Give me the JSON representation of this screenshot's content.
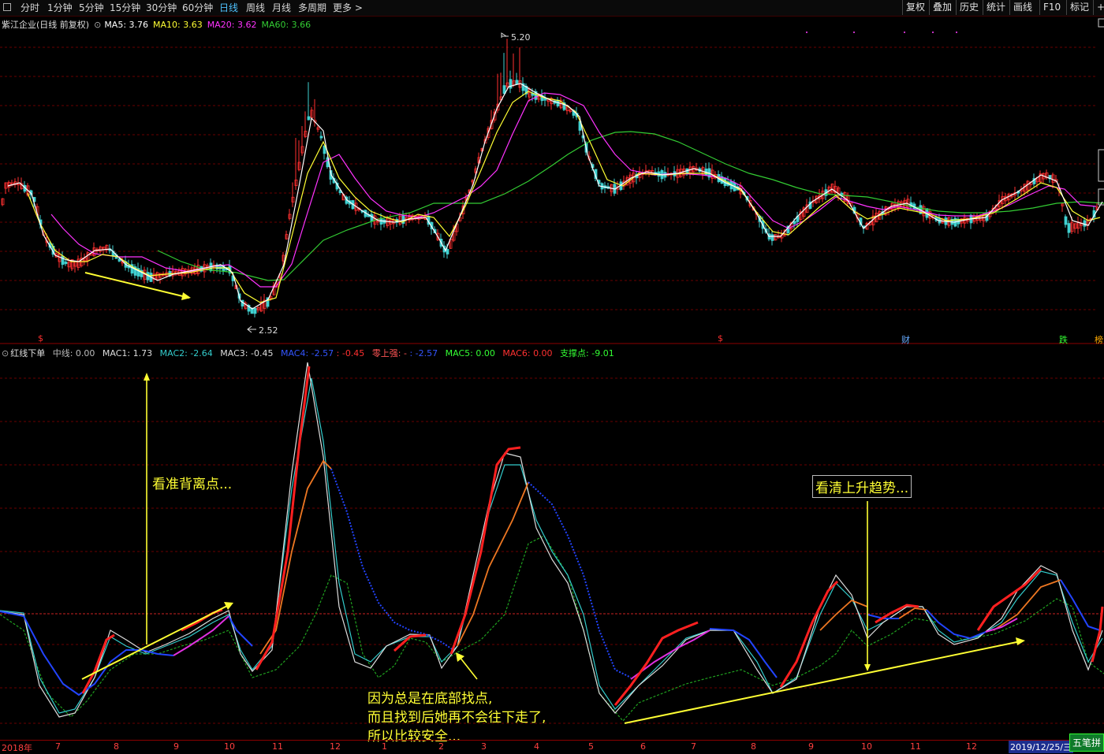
{
  "toolbar": {
    "periods": [
      "分时",
      "1分钟",
      "5分钟",
      "15分钟",
      "30分钟",
      "60分钟",
      "日线",
      "周线",
      "月线",
      "多周期",
      "更多 >"
    ],
    "active_period": "日线",
    "right_buttons": [
      "复权",
      "叠加",
      "历史",
      "统计",
      "画线",
      "F10",
      "标记",
      "+"
    ]
  },
  "price_panel": {
    "title": "紫江企业(日线 前复权)",
    "ma": [
      {
        "label": "MA5: 3.76",
        "color": "#ffffff"
      },
      {
        "label": "MA10: 3.63",
        "color": "#ffff33"
      },
      {
        "label": "MA20: 3.62",
        "color": "#ff33ff"
      },
      {
        "label": "MA60: 3.66",
        "color": "#33cc33"
      }
    ],
    "high_label": "5.20",
    "low_label": "2.52",
    "event_marks": [
      {
        "text": "$",
        "color": "#ff3030"
      },
      {
        "text": "$",
        "color": "#ff3030"
      },
      {
        "text": "财",
        "color": "#66aaff"
      },
      {
        "text": "跌",
        "color": "#33ff33"
      },
      {
        "text": "榜",
        "color": "#ffaa00"
      }
    ]
  },
  "indicator_panel": {
    "name": "红线下单",
    "items": [
      {
        "label": "中线: 0.00",
        "color": "#bbbbbb"
      },
      {
        "label": "MAC1: 1.73",
        "color": "#dddddd"
      },
      {
        "label": "MAC2: -2.64",
        "color": "#33cccc"
      },
      {
        "label": "MAC3: -0.45",
        "color": "#dddddd"
      },
      {
        "label": "MAC4: -2.57",
        "color": "#3355ff"
      },
      {
        "label": ": -0.45",
        "color": "#ff3030"
      },
      {
        "label": "零上强: -",
        "color": "#ff5555"
      },
      {
        "label": ": -2.57",
        "color": "#3355ff"
      },
      {
        "label": "MAC5: 0.00",
        "color": "#33ff33"
      },
      {
        "label": "MAC6: 0.00",
        "color": "#ff3030"
      },
      {
        "label": "支撑点: -9.01",
        "color": "#33ff33"
      }
    ]
  },
  "annotations": {
    "divergence": "看准背离点...",
    "uptrend": "看清上升趋势...",
    "bottom_line1": "因为总是在底部找点,",
    "bottom_line2": "而且找到后她再不会往下走了,",
    "bottom_line3": "所以比较安全..."
  },
  "date_axis": {
    "labels": [
      "2018年",
      "7",
      "8",
      "9",
      "10",
      "11",
      "12",
      "1",
      "2",
      "3",
      "4",
      "5",
      "6",
      "7",
      "8",
      "9",
      "10",
      "11",
      "12"
    ],
    "current": "2019/12/25/三"
  },
  "badge": "五笔拼"
}
